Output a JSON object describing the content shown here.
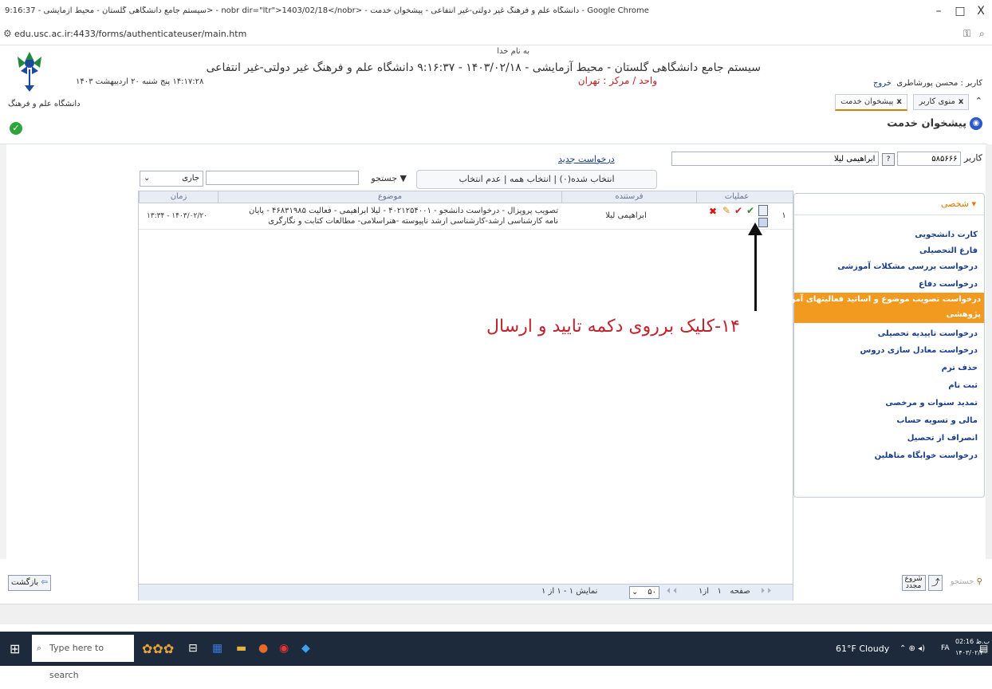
{
  "browser": {
    "title": "سیستم جامع دانشگاهی گلستان - محیط آزمایشی - 9:16:37> - nobr dir=\"ltr\">1403/02/18</nobr> - دانشگاه علم و فرهنگ غیر دولتی-غیر انتفاعی - پیشخوان خدمت - Google Chrome",
    "url": "edu.usc.ac.ir:4433/forms/authenticateuser/main.htm",
    "min": "–",
    "max": "□",
    "close": "X"
  },
  "header": {
    "bismillah": "به نام خدا",
    "title": "سیستم جامع دانشگاهی گلستان - محیط آزمایشی - ۱۴۰۳/۰۲/۱۸ - ۹:۱۶:۳۷   دانشگاه علم و فرهنگ غیر دولتی-غیر انتفاعی",
    "center": "واحد / مرکز : تهران",
    "datetime": "۱۴:۱۷:۲۸ پنج شنبه ۲۰ اردیبهشت ۱۴۰۳",
    "user_label": "کاربر : محسن پورشاطری",
    "logout": "خروج",
    "logo_text": "دانشگاه علم و فرهنگ"
  },
  "tabs": [
    {
      "label": "منوی کاربر",
      "active": false
    },
    {
      "label": "پیشخوان خدمت",
      "active": true
    }
  ],
  "page_heading": "پیشخوان خدمت",
  "user_search": {
    "label": "کاربر",
    "code": "۵۸۵۶۶۶",
    "name": "ابراهیمی لیلا",
    "new_request": "درخواست جدید"
  },
  "toolbar": {
    "selection": "انتخاب شده(۰) | انتخاب همه | عدم انتخاب",
    "search_label": "جستجو",
    "filter_value": "جاری"
  },
  "grid": {
    "columns": [
      "عملیات",
      "فرستنده",
      "موضوع",
      "زمان"
    ],
    "rows": [
      {
        "index": "۱",
        "sender": "ابراهیمی لیلا",
        "subject_line1": "تصویب پروپزال - درخواست دانشجو - ۴۰۲۱۲۵۴۰۰۱ - لیلا ابراهیمی - فعالیت ۴۶۸۳۱۹۸۵ - پایان",
        "subject_line2": "نامه کارشناسی ارشد-کارشناسی ارشد ناپیوسته -هنراسلامی- مطالعات کتابت و نگارگری",
        "time": "۱۴۰۳/۰۲/۲۰ - ۱۳:۳۴"
      }
    ],
    "pager": {
      "page_label": "صفحه",
      "page": "۱",
      "of": "از۱",
      "page_size": "۵۰",
      "summary": "نمایش ۱ - ۱ از ۱"
    }
  },
  "sidebar": {
    "title": "شخصی",
    "items": [
      "کارت دانشجویی",
      "فارغ التحصیلی",
      "درخواست بررسی مشکلات آموزشی",
      "درخواست دفاع",
      "درخواست تصویب موضوع و اساتید فعالیتهای آموزشی-پژوهشی",
      "درخواست تاییدیه تحصیلی",
      "درخواست معادل سازی دروس",
      "حذف ترم",
      "ثبت نام",
      "تمدید سنوات و مرخصی",
      "مالی و تسویه حساب",
      "انصراف از تحصیل",
      "درخواست خوابگاه متاهلین"
    ],
    "active_line1": "درخواست تصویب موضوع و اساتید فعالیتهای آموزشی-",
    "active_line2": "پژوهشی"
  },
  "annotation": "۱۴-کلیک برروی دکمه تایید و ارسال",
  "bottom": {
    "back": "بازگشت",
    "search": "جستجو",
    "restart_1": "شروع",
    "restart_2": "مجدد"
  },
  "taskbar": {
    "search_placeholder": "Type here to search",
    "weather": "61°F  Cloudy",
    "lang": "FA",
    "time": "02:16 ب.ظ",
    "date": "۱۴۰۳/۰۲/۲۰"
  },
  "colors": {
    "accent_orange": "#f29a1f",
    "link_blue": "#1a3e8c",
    "annotation_red": "#c0232e"
  }
}
